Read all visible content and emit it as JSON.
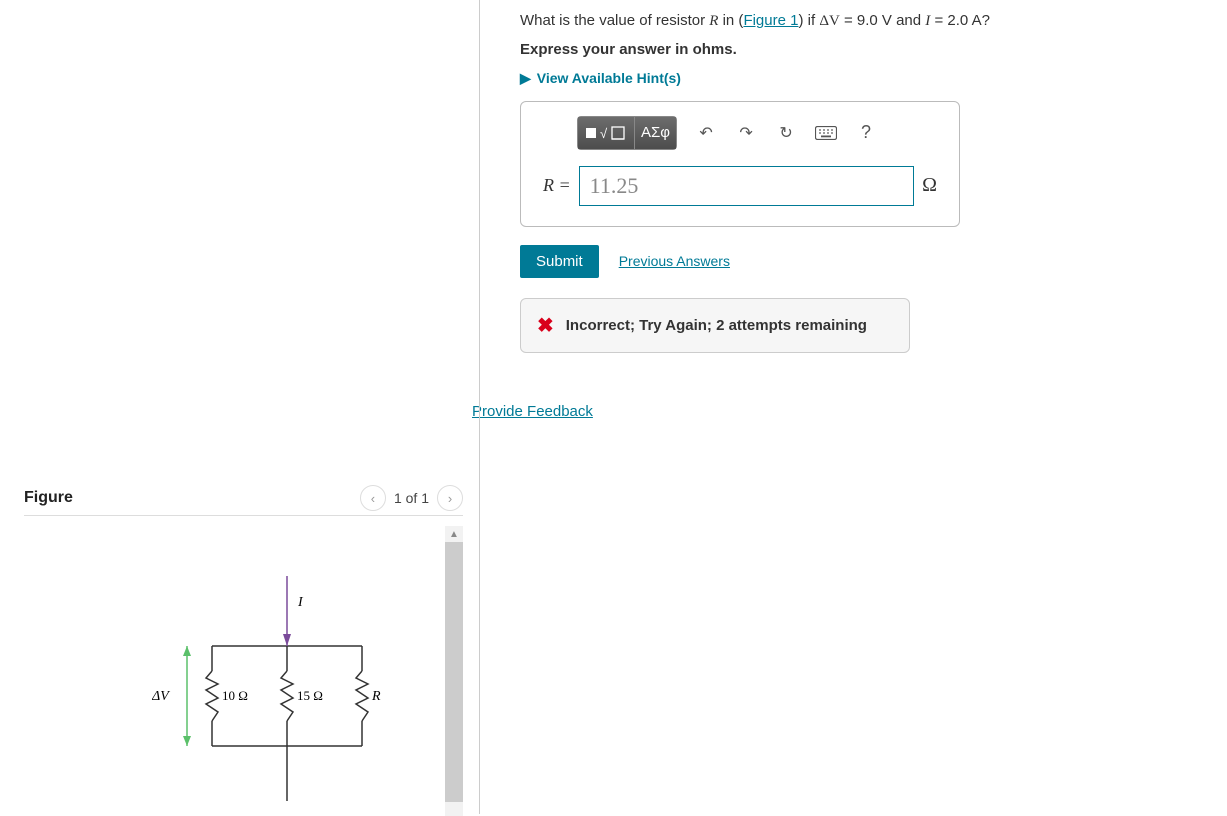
{
  "question": {
    "prefix": "What is the value of resistor ",
    "var_R": "R",
    "mid1": " in (",
    "figure_link": "Figure 1",
    "mid2": ") if ",
    "dv_label": "ΔV",
    "dv_val": " = 9.0 V",
    "and": " and ",
    "I_label": "I",
    "I_val": " = 2.0 A",
    "qmark": "?",
    "express": "Express your answer in ohms.",
    "hints_label": "View Available Hint(s)"
  },
  "toolbar": {
    "templates_icon": "▪√☐",
    "greek": "ΑΣφ",
    "undo": "↶",
    "redo": "↷",
    "reset": "↻",
    "keyboard": "⌨",
    "help": "?"
  },
  "answer": {
    "prefix": "R =",
    "value": "11.25",
    "unit": "Ω"
  },
  "buttons": {
    "submit": "Submit",
    "previous": "Previous Answers"
  },
  "feedback": {
    "text": "Incorrect; Try Again; 2 attempts remaining"
  },
  "links": {
    "provide_feedback": "Provide Feedback"
  },
  "figure": {
    "title": "Figure",
    "pager": "1 of 1",
    "dv": "ΔV",
    "I": "I",
    "r1": "10 Ω",
    "r2": "15 Ω",
    "r3": "R"
  }
}
